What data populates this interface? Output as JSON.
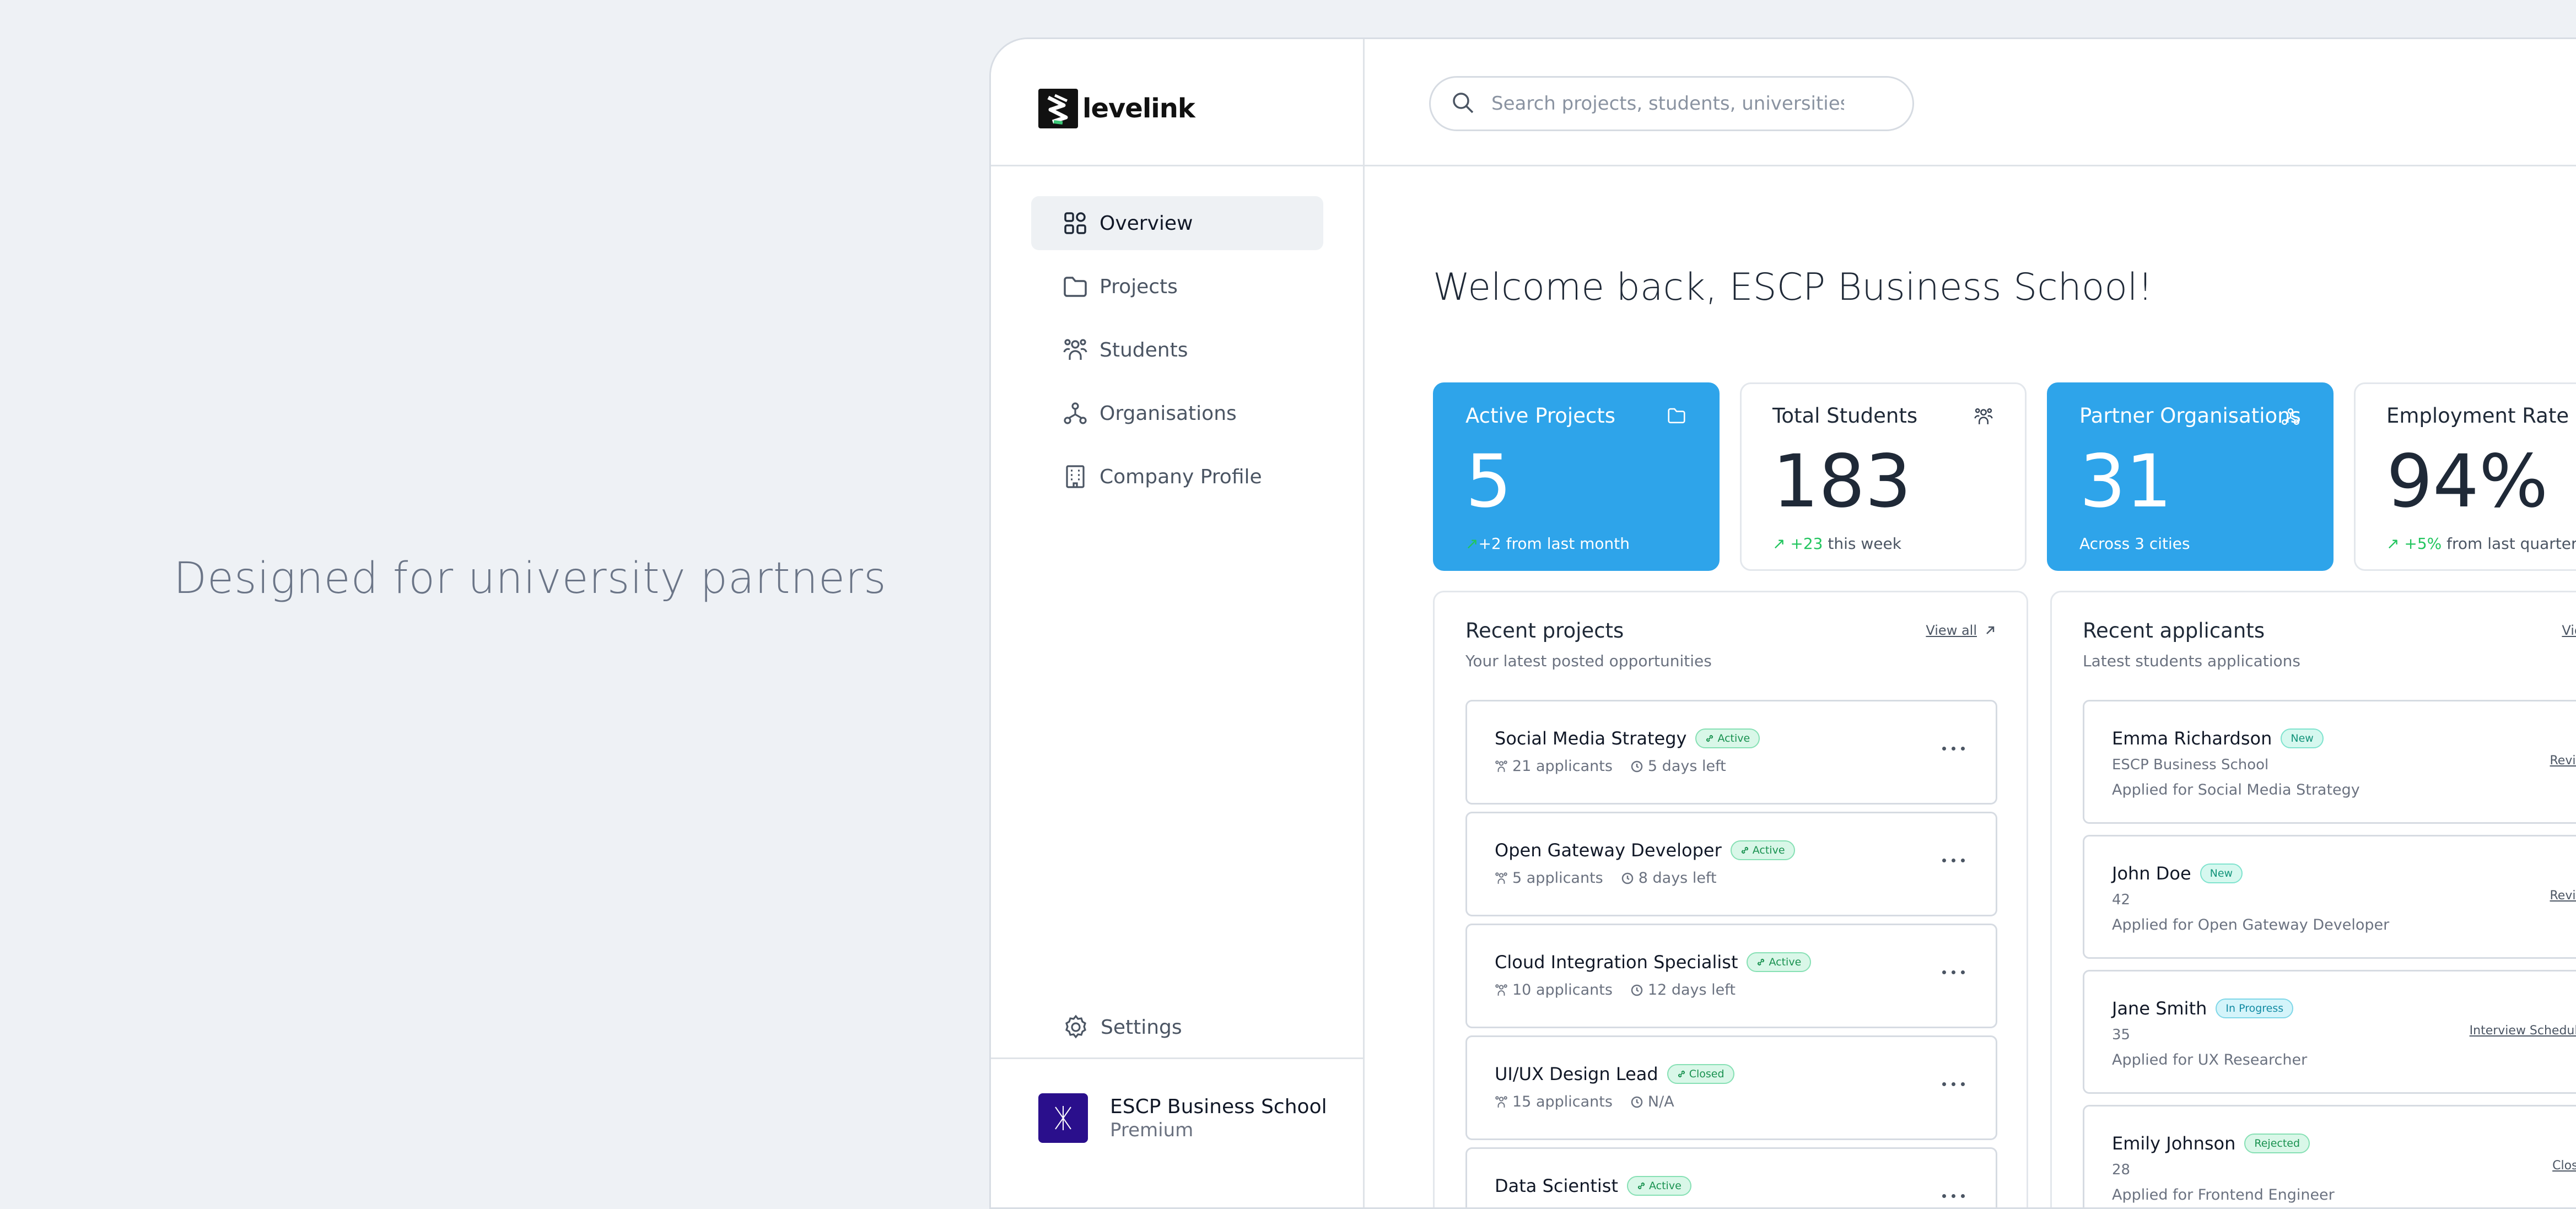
{
  "tagline": "Designed for university partners",
  "brand": {
    "name": "levelink"
  },
  "search": {
    "placeholder": "Search projects, students, universities..."
  },
  "sidebar": {
    "items": [
      {
        "label": "Overview",
        "icon": "grid-icon",
        "active": true
      },
      {
        "label": "Projects",
        "icon": "folder-icon"
      },
      {
        "label": "Students",
        "icon": "users-icon"
      },
      {
        "label": "Organisations",
        "icon": "network-icon"
      },
      {
        "label": "Company Profile",
        "icon": "building-icon"
      }
    ],
    "settings_label": "Settings",
    "account": {
      "name": "ESCP Business School",
      "plan": "Premium"
    }
  },
  "main": {
    "welcome": "Welcome back, ESCP Business School!",
    "stats": [
      {
        "title": "Active Projects",
        "value": "5",
        "delta": "+2",
        "note": " from last month",
        "style": "blue",
        "icon": "folder-icon"
      },
      {
        "title": "Total Students",
        "value": "183",
        "delta": "+23",
        "note": " this week",
        "style": "white",
        "icon": "users-icon"
      },
      {
        "title": "Partner Organisations",
        "value": "31",
        "delta": "",
        "note": "Across 3 cities",
        "style": "blue",
        "icon": "network-icon"
      },
      {
        "title": "Employment Rate",
        "value": "94%",
        "delta": "+5%",
        "note": " from last quarter",
        "style": "white",
        "icon": "trend-icon"
      }
    ],
    "recent_projects": {
      "title": "Recent projects",
      "subtitle": "Your latest posted opportunities",
      "view_all": "View all",
      "items": [
        {
          "name": "Social Media Strategy",
          "status": "Active",
          "applicants": "21 applicants",
          "time": "5 days left"
        },
        {
          "name": "Open Gateway Developer",
          "status": "Active",
          "applicants": "5 applicants",
          "time": "8 days left"
        },
        {
          "name": "Cloud Integration Specialist",
          "status": "Active",
          "applicants": "10 applicants",
          "time": "12 days left"
        },
        {
          "name": "UI/UX Design Lead",
          "status": "Closed",
          "applicants": "15 applicants",
          "time": "N/A"
        },
        {
          "name": "Data Scientist",
          "status": "Active",
          "applicants": "",
          "time": ""
        }
      ]
    },
    "recent_applicants": {
      "title": "Recent applicants",
      "subtitle": "Latest students applications",
      "view_all": "View all",
      "items": [
        {
          "name": "Emma Richardson",
          "status": "New",
          "line1": "ESCP Business School",
          "line2": "Applied for Social Media Strategy",
          "action": "Review"
        },
        {
          "name": "John Doe",
          "status": "New",
          "line1": "42",
          "line2": "Applied for Open Gateway Developer",
          "action": "Review"
        },
        {
          "name": "Jane Smith",
          "status": "In Progress",
          "line1": "35",
          "line2": "Applied for UX Researcher",
          "action": "Interview Scheduled"
        },
        {
          "name": "Emily Johnson",
          "status": "Rejected",
          "line1": "28",
          "line2": "Applied for Frontend Engineer",
          "action": "Closed"
        }
      ]
    }
  },
  "colors": {
    "accent": "#2ea4ea",
    "background": "#eef1f5",
    "success": "#22c55e",
    "account_logo": "#2a0f8c"
  }
}
